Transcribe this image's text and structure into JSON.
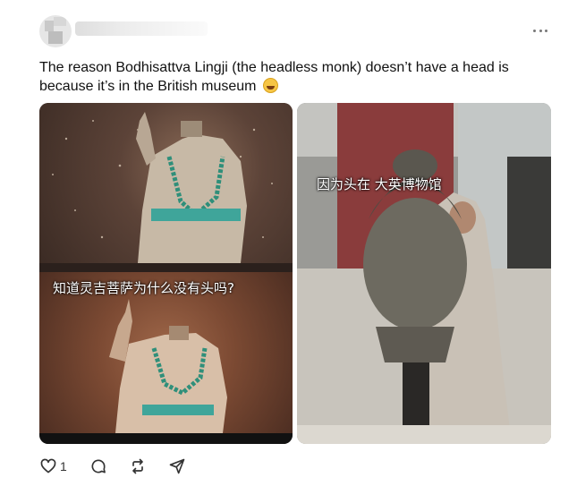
{
  "post": {
    "text": "The reason Bodhisattva Lingji (the headless monk) doesn’t have a head is because it’s in the British museum",
    "emoji": "grinning-squinting-face-with-sweat",
    "images": [
      {
        "caption": "知道灵吉菩萨为什么没有头吗?"
      },
      {
        "caption": "因为头在 大英博物馆"
      }
    ]
  },
  "actions": {
    "like_count": "1",
    "icons": [
      "heart-icon",
      "comment-icon",
      "repost-icon",
      "share-icon"
    ]
  }
}
